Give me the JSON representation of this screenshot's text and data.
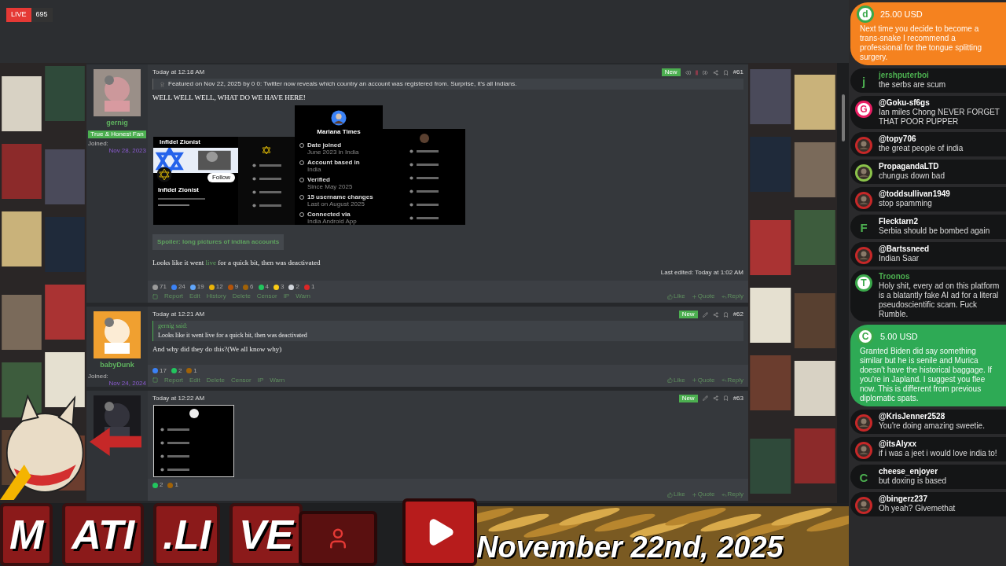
{
  "stream": {
    "live_label": "LIVE",
    "viewers": "695"
  },
  "posts": [
    {
      "author": "gernig",
      "role_badge": "True & Honest Fan",
      "joined_label": "Joined:",
      "joined_date": "Nov 28, 2023",
      "time": "Today at 12:18 AM",
      "new_badge": "New",
      "number": "#61",
      "has_nav": true,
      "checked": false,
      "featured": "Featured on Nov 22, 2025 by 0 0: Twitter now reveals which country an account was registered from. Surprise, it's all Indians.",
      "heading": "WELL WELL WELL, WHAT DO WE HAVE HERE!",
      "embed": {
        "kind": "profiles",
        "left_title": "Infidel Zionist",
        "follow": "Follow",
        "left_name": "Infidel Zionist",
        "center_name": "Mariana Times",
        "rows": [
          {
            "label": "Date joined",
            "value": "June 2023 in India"
          },
          {
            "label": "Account based in",
            "value": "India"
          },
          {
            "label": "Verified",
            "value": "Since May 2025"
          },
          {
            "label": "15 username changes",
            "value": "Last on August 2025"
          },
          {
            "label": "Connected via",
            "value": "India Android App"
          }
        ]
      },
      "spoiler": "Spoiler: long pictures of indian accounts",
      "body": [
        {
          "kind": "text",
          "text": "Looks like it went "
        },
        {
          "kind": "link",
          "text": "live"
        },
        {
          "kind": "text",
          "text": " for a quick bit, then was deactivated"
        }
      ],
      "last_edited": "Last edited: Today at 1:02 AM",
      "reactions": [
        {
          "count": "71",
          "color": "#9a9a9a"
        },
        {
          "count": "24",
          "color": "#3b82f6"
        },
        {
          "count": "19",
          "color": "#60a5fa"
        },
        {
          "count": "12",
          "color": "#eab308"
        },
        {
          "count": "9",
          "color": "#b45309"
        },
        {
          "count": "6",
          "color": "#a16207"
        },
        {
          "count": "4",
          "color": "#22c55e"
        },
        {
          "count": "3",
          "color": "#facc15"
        },
        {
          "count": "2",
          "color": "#d1d5db"
        },
        {
          "count": "1",
          "color": "#dc2626"
        }
      ],
      "actions": [
        "Report",
        "Edit",
        "History",
        "Delete",
        "Censor",
        "IP",
        "Warn"
      ],
      "footer": [
        "Like",
        "Quote",
        "Reply"
      ]
    },
    {
      "author": "babyDunk",
      "joined_label": "Joined:",
      "joined_date": "Nov 24, 2024",
      "time": "Today at 12:21 AM",
      "new_badge": "New",
      "number": "#62",
      "has_nav": false,
      "checked": false,
      "quote_author": "gernig said:",
      "quote": "Looks like it went live for a quick bit, then was deactivated",
      "body": [
        {
          "kind": "text",
          "text": "And why did they do this?(We all know why)"
        }
      ],
      "reactions": [
        {
          "count": "17",
          "color": "#3b82f6"
        },
        {
          "count": "2",
          "color": "#22c55e"
        },
        {
          "count": "1",
          "color": "#a16207"
        }
      ],
      "actions": [
        "Report",
        "Edit",
        "Delete",
        "Censor",
        "IP",
        "Warn"
      ],
      "footer": [
        "Like",
        "Quote",
        "Reply"
      ]
    },
    {
      "time": "Today at 12:22 AM",
      "new_badge": "New",
      "number": "#63",
      "has_nav": false,
      "embed": {
        "kind": "single"
      },
      "reactions": [
        {
          "count": "2",
          "color": "#22c55e"
        },
        {
          "count": "1",
          "color": "#a16207"
        }
      ],
      "footer": [
        "Like",
        "Quote",
        "Reply"
      ]
    }
  ],
  "chat": [
    {
      "kind": "donation",
      "color": "#f5821f",
      "avatar": {
        "kind": "letter-circle",
        "letter": "d",
        "color": "#3aa84a"
      },
      "amount": "25.00 USD",
      "text": "Next time you decide to become a trans-snake I recommend a professional for the tongue splitting surgery."
    },
    {
      "kind": "message",
      "name": "jershputerboi",
      "highlighted": true,
      "avatar": {
        "kind": "letter",
        "letter": "j",
        "color": "#4caf50"
      },
      "text": "the serbs are scum"
    },
    {
      "kind": "message",
      "name": "@Goku-sf6gs",
      "highlighted": false,
      "avatar": {
        "kind": "letter-circle",
        "letter": "G",
        "color": "#e91e63"
      },
      "text": "Ian miles Chong NEVER FORGET THAT POOR PUPPER"
    },
    {
      "kind": "message",
      "name": "@topy706",
      "highlighted": false,
      "text": "the great people of india"
    },
    {
      "kind": "message",
      "name": "PropagandaLTD",
      "highlighted": false,
      "text": "chungus down bad"
    },
    {
      "kind": "message",
      "name": "@toddsullivan1949",
      "highlighted": false,
      "text": "stop spamming"
    },
    {
      "kind": "message",
      "name": "Flecktarn2",
      "highlighted": false,
      "avatar": {
        "kind": "letter",
        "letter": "F",
        "color": "#4caf50"
      },
      "text": "Serbia should be bombed again"
    },
    {
      "kind": "message",
      "name": "@Bartssneed",
      "highlighted": false,
      "text": "Indian Saar"
    },
    {
      "kind": "message",
      "name": "Troonos",
      "highlighted": true,
      "avatar": {
        "kind": "letter-circle",
        "letter": "T",
        "color": "#3aa84a"
      },
      "text": "Holy shit, every ad on this platform is a blatantly fake AI ad for a literal pseudoscientific scam. Fuck Rumble."
    },
    {
      "kind": "donation",
      "color": "#2eaa55",
      "avatar": {
        "kind": "letter-circle",
        "letter": "C",
        "color": "#3aa84a"
      },
      "amount": "5.00 USD",
      "text": "Granted Biden did say something similar but he is senile and Murica doesn't have the historical baggage. If you're in Japland. I suggest you flee now. This is different from previous diplomatic spats."
    },
    {
      "kind": "message",
      "name": "@KrisJenner2528",
      "highlighted": false,
      "text": "You're doing amazing sweetie."
    },
    {
      "kind": "message",
      "name": "@itsAlyxx",
      "highlighted": false,
      "text": "if i was a jeet i would love india to!"
    },
    {
      "kind": "message",
      "name": "cheese_enjoyer",
      "highlighted": false,
      "avatar": {
        "kind": "letter",
        "letter": "C",
        "color": "#4caf50"
      },
      "text": "but doxing is based"
    },
    {
      "kind": "message",
      "name": "@bingerz237",
      "highlighted": false,
      "text": "Oh yeah? Givemethat"
    }
  ],
  "overlay": {
    "logo_letters": [
      "M",
      "ATI",
      ".LI",
      "VE"
    ],
    "date": "November 22nd, 2025"
  }
}
